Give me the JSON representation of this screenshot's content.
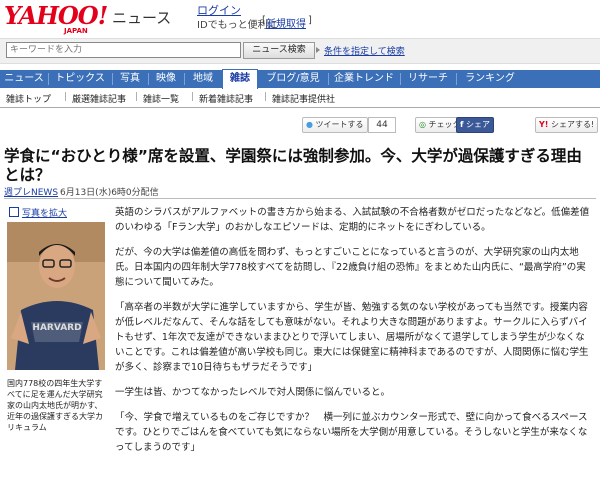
{
  "header": {
    "logo_text": "YAHOO!",
    "logo_sub": "JAPAN",
    "section_label": "ニュース",
    "login_label": "ログイン",
    "login_desc": "IDでもっと便利に",
    "signup_open": "[",
    "signup_label": "新規取得",
    "signup_close": "]"
  },
  "search": {
    "placeholder": "キーワードを入力",
    "button_label": "ニュース検索",
    "advanced_label": "条件を指定して検索"
  },
  "tabs": [
    {
      "label": "ニュース"
    },
    {
      "label": "トピックス"
    },
    {
      "label": "写真"
    },
    {
      "label": "映像"
    },
    {
      "label": "地域"
    },
    {
      "label": "雑誌"
    },
    {
      "label": "ブログ/意見"
    },
    {
      "label": "企業トレンド"
    },
    {
      "label": "リサーチ"
    },
    {
      "label": "ランキング"
    }
  ],
  "active_tab": "雑誌",
  "subnav": [
    {
      "label": "雑誌トップ"
    },
    {
      "label": "厳選雑誌記事"
    },
    {
      "label": "雑誌一覧"
    },
    {
      "label": "新着雑誌記事"
    },
    {
      "label": "雑誌記事提供社"
    }
  ],
  "social": {
    "tweet_label": "ツイートする",
    "tweet_count": "44",
    "check_label": "チェック",
    "share_label": "シェア",
    "yahoo_share_label": "シェアする!"
  },
  "article": {
    "title": "学食に“おひとり様”席を設置、学園祭には強制参加。今、大学が過保護すぎる理由とは？",
    "source": "週プレNEWS",
    "date": "6月13日(水)6時0分配信",
    "zoom_label": "写真を拡大",
    "caption": "国内778校の四年生大学すべてに足を運んだ大学研究家の山内太地氏が明かす、近年の過保護すぎる大学カリキュラム",
    "paragraphs": [
      "英語のシラバスがアルファベットの書き方から始まる、入試試験の不合格者数がゼロだったなどなど。低偏差値のいわゆる「Fラン大学」のおかしなエピソードは、定期的にネットをにぎわしている。",
      "だが、今の大学は偏差値の高低を問わず、もっとすごいことになっていると言うのが、大学研究家の山内太地氏。日本国内の四年制大学778校すべてを訪問し、『22歳負け組の恐怖』をまとめた山内氏に、“最高学府”の実態について聞いてみた。",
      "「高卒者の半数が大学に進学していますから、学生が皆、勉強する気のない学校があっても当然です。授業内容が低レベルだなんて、そんな話をしても意味がない。それより大きな問題がありますよ。サークルに入らずバイトもせず、1年次で友達ができないままひとりで浮いてしまい、居場所がなくて退学してしまう学生が少なくないことです。これは偏差値が高い学校も同じ。東大には保健室に精神科まであるのですが、人間関係に悩む学生が多く、診察まで10日待ちもザラだそうです」",
      "一学生は皆、かつてなかったレベルで対人関係に悩んでいると。",
      "「今、学食で増えているものをご存じですか？　横一列に並ぶカウンター形式で、壁に向かって食べるスペースです。ひとりでごはんを食べていても気にならない場所を大学側が用意している。そうしないと学生が来なくなってしまうのです」"
    ]
  },
  "colors": {
    "tab_bar": "#3b6fb8",
    "link": "#1a3ca5",
    "logo_red": "#e3001b"
  }
}
